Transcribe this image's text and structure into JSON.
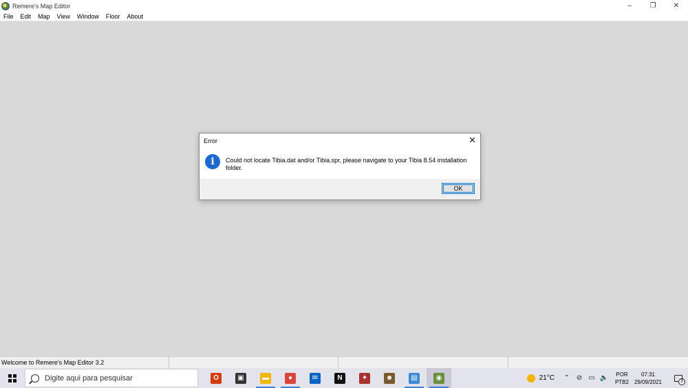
{
  "window": {
    "title": "Remere's Map Editor",
    "minimize": "–",
    "restore": "❐",
    "close": "✕"
  },
  "menu": [
    "File",
    "Edit",
    "Map",
    "View",
    "Window",
    "Floor",
    "About"
  ],
  "dialog": {
    "title": "Error",
    "message": "Could not locate Tibia.dat and/or Tibia.spr, please navigate to your Tibia 8.54 installation folder.",
    "ok_label": "OK",
    "close": "✕",
    "icon_glyph": "i"
  },
  "statusbar": {
    "text": "Welcome to Remere's Map Editor 3.2"
  },
  "taskbar": {
    "search_placeholder": "Digite aqui para pesquisar",
    "apps": [
      {
        "name": "office-icon",
        "glyph": "O",
        "color": "#d83b01",
        "active": false
      },
      {
        "name": "store-icon",
        "glyph": "▣",
        "color": "#333333",
        "active": false
      },
      {
        "name": "file-explorer-icon",
        "glyph": "▬",
        "color": "#f2b705",
        "active": true
      },
      {
        "name": "chrome-icon",
        "glyph": "●",
        "color": "#db4437",
        "active": true
      },
      {
        "name": "mail-icon",
        "glyph": "✉",
        "color": "#0a62c7",
        "active": false
      },
      {
        "name": "netflix-icon",
        "glyph": "N",
        "color": "#111111",
        "active": false
      },
      {
        "name": "game-icon",
        "glyph": "✦",
        "color": "#a8322c",
        "active": false
      },
      {
        "name": "tibia-icon",
        "glyph": "☻",
        "color": "#7a5a2a",
        "active": false
      },
      {
        "name": "settings-app-icon",
        "glyph": "▤",
        "color": "#3d8ad8",
        "active": true
      },
      {
        "name": "rme-icon",
        "glyph": "◉",
        "color": "#6a8f3a",
        "active": true
      }
    ],
    "weather_temp": "21°C",
    "lang_1": "POR",
    "lang_2": "PTB2",
    "time": "07:31",
    "date": "29/09/2021",
    "notification_count": "3"
  }
}
